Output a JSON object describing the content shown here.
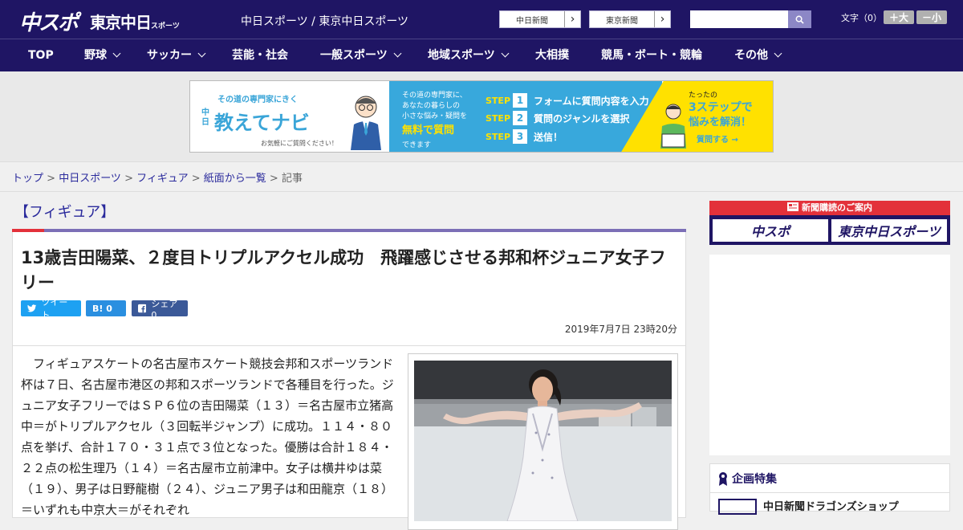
{
  "header": {
    "logo_main": "中スポ",
    "logo_tokyo": "東京中日",
    "logo_tokyo_small": "スポーツ",
    "site_names": "中日スポーツ / 東京中日スポーツ",
    "paper_links": [
      "中日新聞",
      "東京新聞"
    ],
    "search_placeholder": "",
    "font_size_label": "文字（0）",
    "font_larger": "＋大",
    "font_smaller": "－小"
  },
  "nav": [
    {
      "label": "TOP",
      "dropdown": false
    },
    {
      "label": "野球",
      "dropdown": true
    },
    {
      "label": "サッカー",
      "dropdown": true
    },
    {
      "label": "芸能・社会",
      "dropdown": false
    },
    {
      "label": "一般スポーツ",
      "dropdown": true
    },
    {
      "label": "地域スポーツ",
      "dropdown": true
    },
    {
      "label": "大相撲",
      "dropdown": false
    },
    {
      "label": "競馬・ボート・競輪",
      "dropdown": false
    },
    {
      "label": "その他",
      "dropdown": true
    }
  ],
  "banner": {
    "tagline": "その道の専門家にきく",
    "brand_small": "中日",
    "brand": "教えてナビ",
    "note": "お気軽にご質問ください！",
    "mid_lines": [
      "その道の専門家に、",
      "あなたの暮らしの",
      "小さな悩み・疑問を"
    ],
    "mid_highlight": "無料で質問",
    "mid_tail": "できます",
    "steps": [
      {
        "word": "STEP",
        "num": "1",
        "text": "フォームに質問内容を入力"
      },
      {
        "word": "STEP",
        "num": "2",
        "text": "質問のジャンルを選択"
      },
      {
        "word": "STEP",
        "num": "3",
        "text": "送信！"
      }
    ],
    "right_line1": "たったの",
    "right_line2": "3ステップで",
    "right_line3": "悩みを解消！",
    "right_cta": "質問する →"
  },
  "breadcrumb": {
    "items": [
      "トップ",
      "中日スポーツ",
      "フィギュア",
      "紙面から一覧"
    ],
    "current": "記事",
    "sep": " > "
  },
  "article": {
    "category": "【フィギュア】",
    "headline": "13歳吉田陽菜、２度目トリプルアクセル成功　飛躍感じさせる邦和杯ジュニア女子フリー",
    "share_tweet": "ツイート",
    "share_hatena": "B! 0",
    "share_facebook": "シェア 0",
    "date": "2019年7月7日 23時20分",
    "body": "フィギュアスケートの名古屋市スケート競技会邦和スポーツランド杯は７日、名古屋市港区の邦和スポーツランドで各種目を行った。ジュニア女子フリーではＳＰ６位の吉田陽菜（１３）＝名古屋市立猪高中＝がトリプルアクセル（３回転半ジャンプ）に成功。１１４・８０点を挙げ、合計１７０・３１点で３位となった。優勝は合計１８４・２２点の松生理乃（１４）＝名古屋市立前津中。女子は横井ゆは菜（１９）、男子は日野龍樹（２４）、ジュニア男子は和田龍京（１８）＝いずれも中京大＝がそれぞれ"
  },
  "sidebar": {
    "subscribe_head": "新聞購読のご案内",
    "subscribe_btns": [
      "中スポ",
      "東京中日スポーツ"
    ],
    "feature_title": "企画特集",
    "feature_item": "中日新聞ドラゴンズショップ"
  },
  "colors": {
    "navy": "#1f1564",
    "accent_red": "#e3313a",
    "link_blue": "#2a2a9c",
    "banner_blue": "#38a8dc",
    "banner_yellow": "#ffe100"
  }
}
